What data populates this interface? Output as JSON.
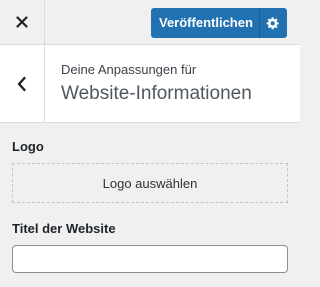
{
  "topbar": {
    "close_icon": "close-icon",
    "publish_label": "Veröffentlichen",
    "publish_settings_icon": "gear-icon",
    "accent_color": "#2271b1"
  },
  "section": {
    "back_icon": "chevron-left-icon",
    "subtitle": "Deine Anpassungen für",
    "title": "Website-Informationen"
  },
  "logo": {
    "label": "Logo",
    "select_button_label": "Logo auswählen"
  },
  "site_title": {
    "label": "Titel der Website",
    "value": ""
  }
}
